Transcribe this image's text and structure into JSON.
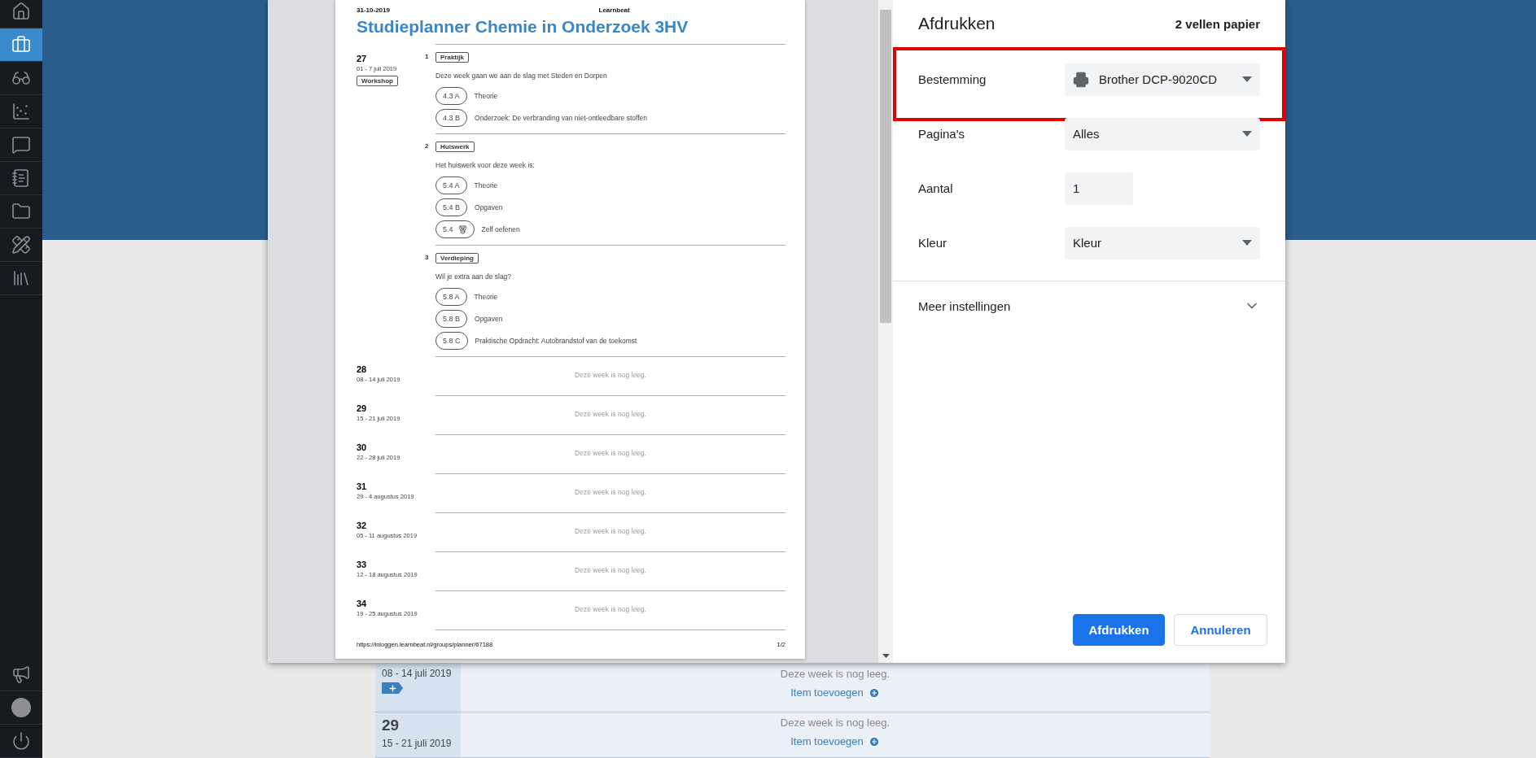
{
  "sidebar": {
    "items": [
      {
        "selected": false
      },
      {
        "selected": true
      },
      {
        "selected": false
      },
      {
        "selected": false
      },
      {
        "selected": false
      },
      {
        "selected": false
      },
      {
        "selected": false
      },
      {
        "selected": false
      },
      {
        "selected": false
      }
    ]
  },
  "planner_background": {
    "rows": [
      {
        "date": "08 - 14 juli 2019",
        "add_tag": true,
        "empty_text": "Deze week is nog leeg.",
        "add_link": "Item toevoegen"
      },
      {
        "week": "29",
        "date": "15 - 21 juli 2019",
        "add_tag": false,
        "empty_text": "Deze week is nog leeg.",
        "add_link": "Item toevoegen"
      }
    ]
  },
  "print_preview": {
    "header_date": "31-10-2019",
    "header_site": "Learnbeat",
    "title": "Studieplanner Chemie in Onderzoek 3HV",
    "weeks": [
      {
        "week": "27",
        "date": "01 - 7 juli 2019",
        "tag": "Workshop",
        "sections": [
          {
            "number": "1",
            "label": "Praktijk",
            "intro": "Deze week gaan we aan de slag met Steden en Dorpen",
            "items": [
              {
                "kind": "paragraph",
                "code": "4.3 A",
                "text": "Theorie"
              },
              {
                "kind": "paragraph",
                "code": "4.3 B",
                "text": "Onderzoek: De verbranding van niet-ontleedbare stoffen"
              }
            ]
          },
          {
            "number": "2",
            "label": "Huiswerk",
            "intro": "Het huiswerk voor deze week is:",
            "items": [
              {
                "kind": "paragraph",
                "code": "5.4 A",
                "text": "Theorie"
              },
              {
                "kind": "paragraph",
                "code": "5.4 B",
                "text": "Opgaven"
              },
              {
                "kind": "practice",
                "code": "5.4",
                "text": "Zelf oefenen"
              }
            ]
          },
          {
            "number": "3",
            "label": "Verdieping",
            "intro": "Wil je extra aan de slag?",
            "items": [
              {
                "kind": "paragraph",
                "code": "5.8 A",
                "text": "Theorie"
              },
              {
                "kind": "paragraph",
                "code": "5.8 B",
                "text": "Opgaven"
              },
              {
                "kind": "paragraph",
                "code": "5.8 C",
                "text": "Praktische Opdracht: Autobrandstof van de toekomst"
              }
            ]
          }
        ]
      },
      {
        "week": "28",
        "date": "08 - 14 juli 2019",
        "empty_text": "Deze week is nog leeg."
      },
      {
        "week": "29",
        "date": "15 - 21 juli 2019",
        "empty_text": "Deze week is nog leeg."
      },
      {
        "week": "30",
        "date": "22 - 28 juli 2019",
        "empty_text": "Deze week is nog leeg."
      },
      {
        "week": "31",
        "date": "29 - 4 augustus 2019",
        "empty_text": "Deze week is nog leeg."
      },
      {
        "week": "32",
        "date": "05 - 11 augustus 2019",
        "empty_text": "Deze week is nog leeg."
      },
      {
        "week": "33",
        "date": "12 - 18 augustus 2019",
        "empty_text": "Deze week is nog leeg."
      },
      {
        "week": "34",
        "date": "19 - 25 augustus 2019",
        "empty_text": "Deze week is nog leeg."
      }
    ],
    "footer_url": "https://inloggen.learnbeat.nl/groups/planner/67188",
    "page_number": "1/2"
  },
  "print_panel": {
    "title": "Afdrukken",
    "sheets": "2 vellen papier",
    "settings": [
      {
        "kind": "select",
        "label": "Bestemming",
        "value": "Brother DCP-9020CD",
        "printer_icon": true,
        "highlighted": true
      },
      {
        "kind": "select",
        "label": "Pagina's",
        "value": "Alles",
        "printer_icon": false,
        "highlighted": false
      },
      {
        "kind": "number",
        "label": "Aantal",
        "value": "1",
        "printer_icon": false,
        "highlighted": false
      },
      {
        "kind": "select",
        "label": "Kleur",
        "value": "Kleur",
        "printer_icon": false,
        "highlighted": false
      }
    ],
    "more_settings": {
      "label": "Meer instellingen",
      "expanded": false
    },
    "buttons": [
      {
        "label": "Afdrukken",
        "kind": "primary"
      },
      {
        "label": "Annuleren",
        "kind": "secondary"
      }
    ]
  }
}
